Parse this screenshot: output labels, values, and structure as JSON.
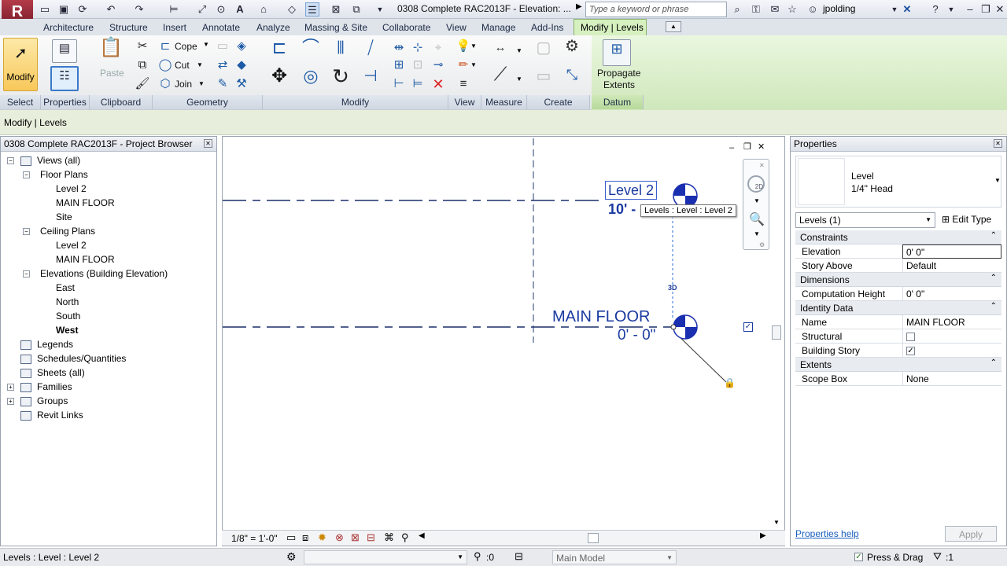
{
  "app": {
    "logo_letter": "R",
    "title": "0308 Complete RAC2013F - Elevation: ...",
    "search_placeholder": "Type a keyword or phrase",
    "user": "jpolding"
  },
  "tabs": [
    "Architecture",
    "Structure",
    "Insert",
    "Annotate",
    "Analyze",
    "Massing & Site",
    "Collaborate",
    "View",
    "Manage",
    "Add-Ins"
  ],
  "active_tab": "Modify | Levels",
  "ribbon": {
    "modify_label": "Modify",
    "paste_label": "Paste",
    "cope_label": "Cope",
    "cut_label": "Cut",
    "join_label": "Join",
    "propagate_label": "Propagate",
    "extents_label": "Extents",
    "panels": [
      "Select",
      "Properties",
      "Clipboard",
      "Geometry",
      "Modify",
      "View",
      "Measure",
      "Create",
      "Datum"
    ]
  },
  "options_bar": {
    "label": "Modify | Levels"
  },
  "project_browser": {
    "title": "0308 Complete RAC2013F - Project Browser",
    "items": [
      {
        "label": "Views (all)",
        "level": 0,
        "expander": "−"
      },
      {
        "label": "Floor Plans",
        "level": 1,
        "expander": "−"
      },
      {
        "label": "Level 2",
        "level": 2
      },
      {
        "label": "MAIN FLOOR",
        "level": 2
      },
      {
        "label": "Site",
        "level": 2
      },
      {
        "label": "Ceiling Plans",
        "level": 1,
        "expander": "−"
      },
      {
        "label": "Level 2",
        "level": 2
      },
      {
        "label": "MAIN FLOOR",
        "level": 2
      },
      {
        "label": "Elevations (Building Elevation)",
        "level": 1,
        "expander": "−"
      },
      {
        "label": "East",
        "level": 2
      },
      {
        "label": "North",
        "level": 2
      },
      {
        "label": "South",
        "level": 2
      },
      {
        "label": "West",
        "level": 2,
        "bold": true
      },
      {
        "label": "Legends",
        "level": 0
      },
      {
        "label": "Schedules/Quantities",
        "level": 0
      },
      {
        "label": "Sheets (all)",
        "level": 0
      },
      {
        "label": "Families",
        "level": 0,
        "expander": "+"
      },
      {
        "label": "Groups",
        "level": 0,
        "expander": "+"
      },
      {
        "label": "Revit Links",
        "level": 0
      }
    ]
  },
  "canvas": {
    "level2_name": "Level 2",
    "level2_elev": "10' -",
    "tooltip": "Levels : Level : Level 2",
    "main_name": "MAIN FLOOR",
    "main_elev": "0' - 0\"",
    "tag_3d": "3D",
    "nav_2d": "2D",
    "scale": "1/8\" = 1'-0\""
  },
  "properties": {
    "title": "Properties",
    "type_name": "Level",
    "type_sub": "1/4\" Head",
    "filter": "Levels (1)",
    "edit_type": "Edit Type",
    "rows": [
      {
        "cat": "Constraints"
      },
      {
        "k": "Elevation",
        "v": "0'  0\"",
        "editing": true
      },
      {
        "k": "Story Above",
        "v": "Default"
      },
      {
        "cat": "Dimensions"
      },
      {
        "k": "Computation Height",
        "v": "0'  0\""
      },
      {
        "cat": "Identity Data"
      },
      {
        "k": "Name",
        "v": "MAIN FLOOR"
      },
      {
        "k": "Structural",
        "check": false
      },
      {
        "k": "Building Story",
        "check": true
      },
      {
        "cat": "Extents"
      },
      {
        "k": "Scope Box",
        "v": "None"
      }
    ],
    "help": "Properties help",
    "apply": "Apply"
  },
  "status": {
    "text": "Levels : Level : Level 2",
    "count": ":0",
    "model": "Main Model",
    "press_drag": "Press & Drag",
    "filter_count": ":1"
  }
}
